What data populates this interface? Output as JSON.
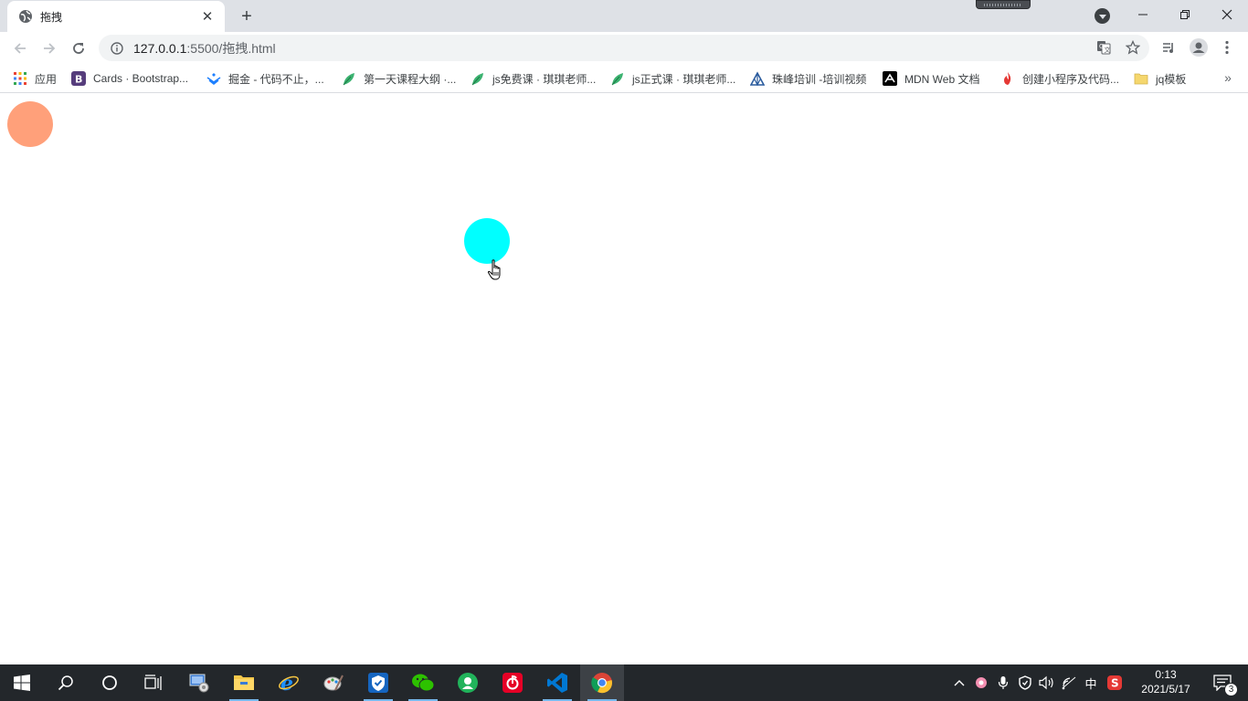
{
  "browser": {
    "tab": {
      "title": "拖拽",
      "close": "✕"
    },
    "new_tab": "+",
    "window_controls": {
      "minimize": "—",
      "restore": "❐",
      "close": "✕"
    },
    "address": {
      "host": "127.0.0.1",
      "rest": ":5500/拖拽.html"
    },
    "bookmarks": [
      {
        "label": "应用",
        "icon": "apps-grid-icon"
      },
      {
        "label": "Cards · Bootstrap...",
        "icon": "bootstrap-icon"
      },
      {
        "label": "掘金 - 代码不止，...",
        "icon": "juejin-icon"
      },
      {
        "label": "第一天课程大纲 ·...",
        "icon": "leaf-icon"
      },
      {
        "label": "js免费课 · 琪琪老师...",
        "icon": "leaf-icon"
      },
      {
        "label": "js正式课 · 琪琪老师...",
        "icon": "leaf-icon"
      },
      {
        "label": "珠峰培训 -培训视频",
        "icon": "mountain-icon"
      },
      {
        "label": "MDN Web 文档",
        "icon": "mdn-icon"
      },
      {
        "label": "创建小程序及代码...",
        "icon": "flame-icon"
      },
      {
        "label": "jq模板",
        "icon": "folder-icon"
      }
    ],
    "bookmarks_more": "»"
  },
  "page": {
    "circles": [
      {
        "name": "salmon-circle",
        "color": "#ffa07a"
      },
      {
        "name": "cyan-circle",
        "color": "#00ffff"
      }
    ]
  },
  "taskbar": {
    "apps": [
      "start-icon",
      "search-icon",
      "cortana-icon",
      "task-view-icon",
      "control-panel-icon",
      "file-explorer-icon",
      "internet-explorer-icon",
      "paint-icon",
      "security-icon",
      "wechat-icon",
      "app-green-icon",
      "netease-music-icon",
      "vscode-icon",
      "chrome-icon"
    ],
    "tray": {
      "ime": "中"
    },
    "clock": {
      "time": "0:13",
      "date": "2021/5/17"
    },
    "notifications": "3"
  }
}
